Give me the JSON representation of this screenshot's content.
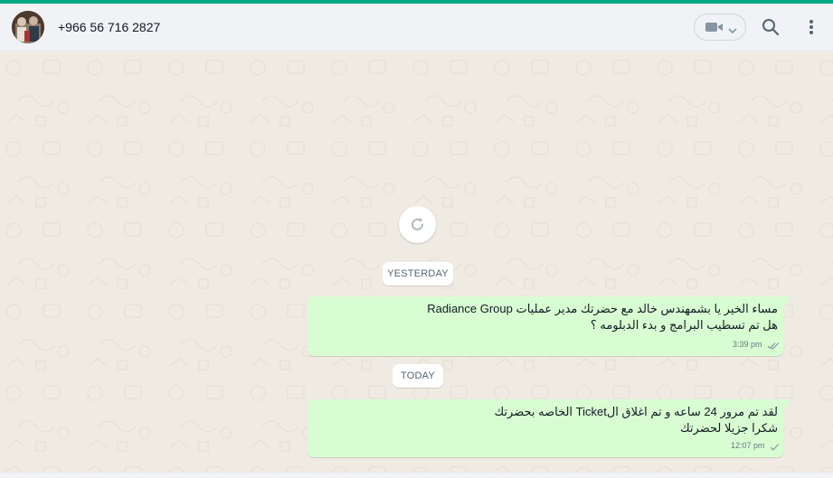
{
  "colors": {
    "accent": "#00a884",
    "header_bg": "#f0f2f5",
    "chat_bg": "#efeae2",
    "outgoing_bubble": "#d9fdd3",
    "read_tick": "#8696a0"
  },
  "header": {
    "contact_name": "+966 56 716 2827",
    "avatar_icon": "contact-avatar",
    "video_call_icon": "video-camera-icon",
    "dropdown_icon": "chevron-down-icon",
    "search_icon": "search-icon",
    "menu_icon": "kebab-menu-icon"
  },
  "chat": {
    "reload_icon": "refresh-icon",
    "date_dividers": [
      "YESTERDAY",
      "TODAY"
    ],
    "messages": [
      {
        "direction": "outgoing",
        "lines": [
          "مساء الخير يا بشمهندس خالد مع حضرتك  مدير عمليات Radiance Group",
          "هل تم تسطيب البرامج و بدء الدبلومه ؟"
        ],
        "time": "3:39 pm",
        "status": "delivered-double-tick"
      },
      {
        "direction": "outgoing",
        "lines": [
          "لقد تم مرور  24 ساعه و تم اغلاق الTicket الخاصه بحضرتك",
          "شكرا جزيلا لحضرتك"
        ],
        "time": "12:07 pm",
        "status": "sent-single-tick"
      }
    ]
  }
}
